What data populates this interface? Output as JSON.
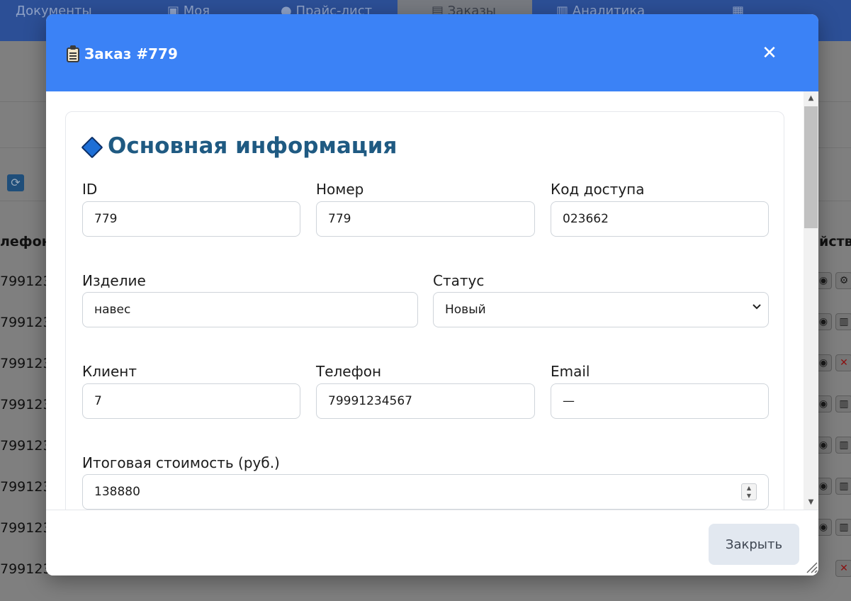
{
  "background": {
    "tabs": [
      {
        "label": "Документы"
      },
      {
        "label": "Моя",
        "icon": "house-icon"
      },
      {
        "label": "Прайс-лист",
        "icon": "money-bag-icon"
      },
      {
        "label": "Заказы",
        "icon": "clipboard-icon",
        "active": true
      },
      {
        "label": "Аналитика",
        "icon": "chart-icon"
      },
      {
        "label": "",
        "icon": "books-icon"
      }
    ],
    "table": {
      "phone_header": "лефон",
      "actions_header": "йств",
      "phone_rows": [
        "799123",
        "799123",
        "799123",
        "799123",
        "799123",
        "799123",
        "799123",
        "799123"
      ]
    }
  },
  "modal": {
    "title": "Заказ #779",
    "title_icon": "clipboard-icon",
    "close_symbol": "✕",
    "section": {
      "title": "Основная информация",
      "icon": "blue-diamond-icon",
      "fields": {
        "id": {
          "label": "ID",
          "value": "779"
        },
        "number": {
          "label": "Номер",
          "value": "779"
        },
        "access_code": {
          "label": "Код доступа",
          "value": "023662"
        },
        "product": {
          "label": "Изделие",
          "value": "навес"
        },
        "status": {
          "label": "Статус",
          "value": "Новый"
        },
        "client": {
          "label": "Клиент",
          "value": "7"
        },
        "phone": {
          "label": "Телефон",
          "value": "79991234567"
        },
        "email": {
          "label": "Email",
          "value": "—"
        },
        "total_cost": {
          "label": "Итоговая стоимость (руб.)",
          "value": "138880"
        }
      }
    },
    "footer": {
      "close_label": "Закрыть"
    }
  },
  "colors": {
    "header_blue": "#3b82f6",
    "section_title": "#1f5a82",
    "footer_button_bg": "#e2e8f0"
  }
}
